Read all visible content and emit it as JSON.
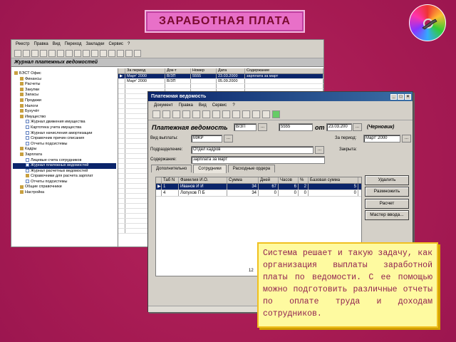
{
  "slide": {
    "title": "ЗАРАБОТНАЯ ПЛАТА",
    "note_text": "Система решает и такую задачу, как организация выплаты заработной платы по ведомости. С ее помощью можно подготовить различные отчеты по оплате труда и доходам сотрудников."
  },
  "back_window": {
    "menu": [
      "Реестр",
      "Правка",
      "Вид",
      "Переход",
      "Закладки",
      "Сервис",
      "?"
    ],
    "journal_title": "Журнал платежных ведомостей",
    "tree": [
      {
        "label": "БЭСТ Офис",
        "level": 0,
        "type": "folder"
      },
      {
        "label": "Финансы",
        "level": 1,
        "type": "folder"
      },
      {
        "label": "Расчеты",
        "level": 1,
        "type": "folder"
      },
      {
        "label": "Закупки",
        "level": 1,
        "type": "folder"
      },
      {
        "label": "Запасы",
        "level": 1,
        "type": "folder"
      },
      {
        "label": "Продажи",
        "level": 1,
        "type": "folder"
      },
      {
        "label": "Налоги",
        "level": 1,
        "type": "folder"
      },
      {
        "label": "Бухучёт",
        "level": 1,
        "type": "folder"
      },
      {
        "label": "Имущество",
        "level": 1,
        "type": "folder"
      },
      {
        "label": "Журнал движения имущества",
        "level": 2,
        "type": "doc"
      },
      {
        "label": "Картотека учета имущества",
        "level": 2,
        "type": "doc"
      },
      {
        "label": "Журнал начисления амортизации",
        "level": 2,
        "type": "doc"
      },
      {
        "label": "Справочник причин списания",
        "level": 2,
        "type": "doc"
      },
      {
        "label": "Отчеты подсистемы",
        "level": 2,
        "type": "doc"
      },
      {
        "label": "Кадры",
        "level": 1,
        "type": "folder"
      },
      {
        "label": "Зарплата",
        "level": 1,
        "type": "folder"
      },
      {
        "label": "Лицевые счета сотрудников",
        "level": 2,
        "type": "doc"
      },
      {
        "label": "Журнал платежных ведомостей",
        "level": 2,
        "type": "doc",
        "selected": true
      },
      {
        "label": "Журнал расчетных ведомостей",
        "level": 2,
        "type": "doc"
      },
      {
        "label": "Справочники для расчета зарплат",
        "level": 2,
        "type": "folder"
      },
      {
        "label": "Отчеты подсистемы",
        "level": 2,
        "type": "doc"
      },
      {
        "label": "Общие справочники",
        "level": 1,
        "type": "folder"
      },
      {
        "label": "Настройка",
        "level": 1,
        "type": "folder"
      }
    ],
    "table_headers": [
      "",
      "За период",
      "Док-т",
      "Номер",
      "Дата",
      "Содержание"
    ],
    "table_rows": [
      {
        "marker": "▶",
        "period": "Март' 2000",
        "doc": "В/ЗП",
        "number": "5555",
        "date": "23.03.2000",
        "content": "зарплата за март",
        "selected": true
      },
      {
        "marker": "",
        "period": "Март' 2000",
        "doc": "В/ЗП",
        "number": "",
        "date": "05.09.2000",
        "content": "",
        "selected": false
      }
    ]
  },
  "front_window": {
    "title": "Платежная ведомость",
    "menu": [
      "Документ",
      "Правка",
      "Вид",
      "Сервис",
      "?"
    ],
    "doc_label": "Платежная ведомость",
    "doc_type": "В/ЗП",
    "doc_number": "5555",
    "date_label": "от",
    "date_value": "23.03.200",
    "status": "(Черновик)",
    "payment_type_label": "Вид выплаты:",
    "payment_type_value": "МЖР",
    "period_label": "За период:",
    "period_value": "Март' 2000",
    "closed_label": "Закрыта:",
    "department_label": "Подразделение:",
    "department_value": "Отдел кадров",
    "content_label": "Содержание:",
    "content_value": "зарплата за март",
    "tabs": [
      "Дополнительно",
      "Сотрудники",
      "Расходные ордера"
    ],
    "active_tab": 1,
    "grid_headers": [
      "",
      "Таб N",
      "Фамилия И.О.",
      "Сумма",
      "Дней",
      "Часов",
      "%",
      "Базовая сумма"
    ],
    "grid_rows": [
      {
        "marker": "▶",
        "tab": "1",
        "name": "Иванов И И",
        "sum": "34",
        "days": "67",
        "hours": "6",
        "pct": "2",
        "base": "5",
        "selected": true
      },
      {
        "marker": "",
        "tab": "4",
        "name": "Лопухов П Б",
        "sum": "34",
        "days": "0",
        "hours": "0",
        "pct": "0",
        "base": "0",
        "selected": false
      }
    ],
    "grid_total": "12",
    "buttons": [
      "Удалить",
      "Размножить",
      "Расчет",
      "Мастер ввода..."
    ]
  }
}
